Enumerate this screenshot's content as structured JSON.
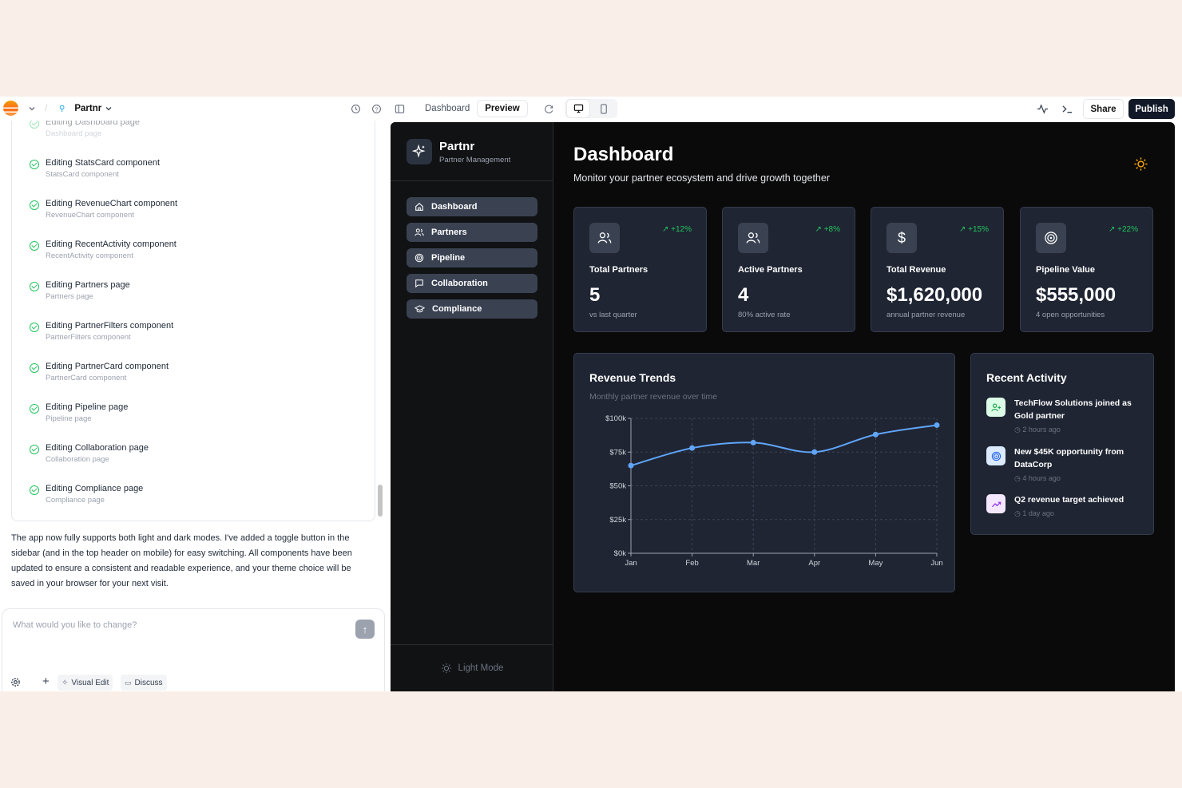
{
  "editor": {
    "project_name": "Partnr",
    "view_tabs": [
      "Dashboard",
      "Preview"
    ],
    "share_label": "Share",
    "publish_label": "Publish"
  },
  "chat": {
    "steps": [
      {
        "title": "Editing Dashboard page",
        "sub": "Dashboard page"
      },
      {
        "title": "Editing StatsCard component",
        "sub": "StatsCard component"
      },
      {
        "title": "Editing RevenueChart component",
        "sub": "RevenueChart component"
      },
      {
        "title": "Editing RecentActivity component",
        "sub": "RecentActivity component"
      },
      {
        "title": "Editing Partners page",
        "sub": "Partners page"
      },
      {
        "title": "Editing PartnerFilters component",
        "sub": "PartnerFilters component"
      },
      {
        "title": "Editing PartnerCard component",
        "sub": "PartnerCard component"
      },
      {
        "title": "Editing Pipeline page",
        "sub": "Pipeline page"
      },
      {
        "title": "Editing Collaboration page",
        "sub": "Collaboration page"
      },
      {
        "title": "Editing Compliance page",
        "sub": "Compliance page"
      }
    ],
    "message": "The app now fully supports both light and dark modes. I've added a toggle button in the sidebar (and in the top header on mobile) for easy switching. All components have been updated to ensure a consistent and readable experience, and your theme choice will be saved in your browser for your next visit.",
    "prompt_placeholder": "What would you like to change?",
    "visual_edit_label": "Visual Edit",
    "discuss_label": "Discuss"
  },
  "app": {
    "brand": "Partnr",
    "brand_sub": "Partner Management",
    "nav": [
      {
        "label": "Dashboard",
        "icon": "home-icon"
      },
      {
        "label": "Partners",
        "icon": "users-icon"
      },
      {
        "label": "Pipeline",
        "icon": "target-icon"
      },
      {
        "label": "Collaboration",
        "icon": "message-icon"
      },
      {
        "label": "Compliance",
        "icon": "graduation-cap-icon"
      }
    ],
    "light_mode_label": "Light Mode",
    "page_title": "Dashboard",
    "page_subtitle": "Monitor your partner ecosystem and drive growth together",
    "stats": [
      {
        "label": "Total Partners",
        "value": "5",
        "trend": "+12%",
        "sub": "vs last quarter",
        "icon": "users-icon"
      },
      {
        "label": "Active Partners",
        "value": "4",
        "trend": "+8%",
        "sub": "80% active rate",
        "icon": "users-icon"
      },
      {
        "label": "Total Revenue",
        "value": "$1,620,000",
        "trend": "+15%",
        "sub": "annual partner revenue",
        "icon": "dollar-icon"
      },
      {
        "label": "Pipeline Value",
        "value": "$555,000",
        "trend": "+22%",
        "sub": "4 open opportunities",
        "icon": "target-icon"
      }
    ],
    "revenue": {
      "title": "Revenue Trends",
      "subtitle": "Monthly partner revenue over time"
    },
    "activity": {
      "title": "Recent Activity",
      "items": [
        {
          "text": "TechFlow Solutions joined as Gold partner",
          "time": "2 hours ago",
          "icon": "user-plus-icon",
          "color": "#dcfce7",
          "fg": "#16a34a"
        },
        {
          "text": "New $45K opportunity from DataCorp",
          "time": "4 hours ago",
          "icon": "target-icon",
          "color": "#dbeafe",
          "fg": "#2563eb"
        },
        {
          "text": "Q2 revenue target achieved",
          "time": "1 day ago",
          "icon": "trending-up-icon",
          "color": "#f3e8ff",
          "fg": "#9333ea"
        }
      ]
    }
  },
  "chart_data": {
    "type": "line",
    "title": "Revenue Trends",
    "categories": [
      "Jan",
      "Feb",
      "Mar",
      "Apr",
      "May",
      "Jun"
    ],
    "series": [
      {
        "values": [
          65000,
          78000,
          82000,
          75000,
          88000,
          95000
        ]
      }
    ],
    "ylim": [
      0,
      100000
    ],
    "yticks": [
      "$0k",
      "$25k",
      "$50k",
      "$75k",
      "$100k"
    ],
    "grid": true,
    "color": "#60a5fa"
  }
}
